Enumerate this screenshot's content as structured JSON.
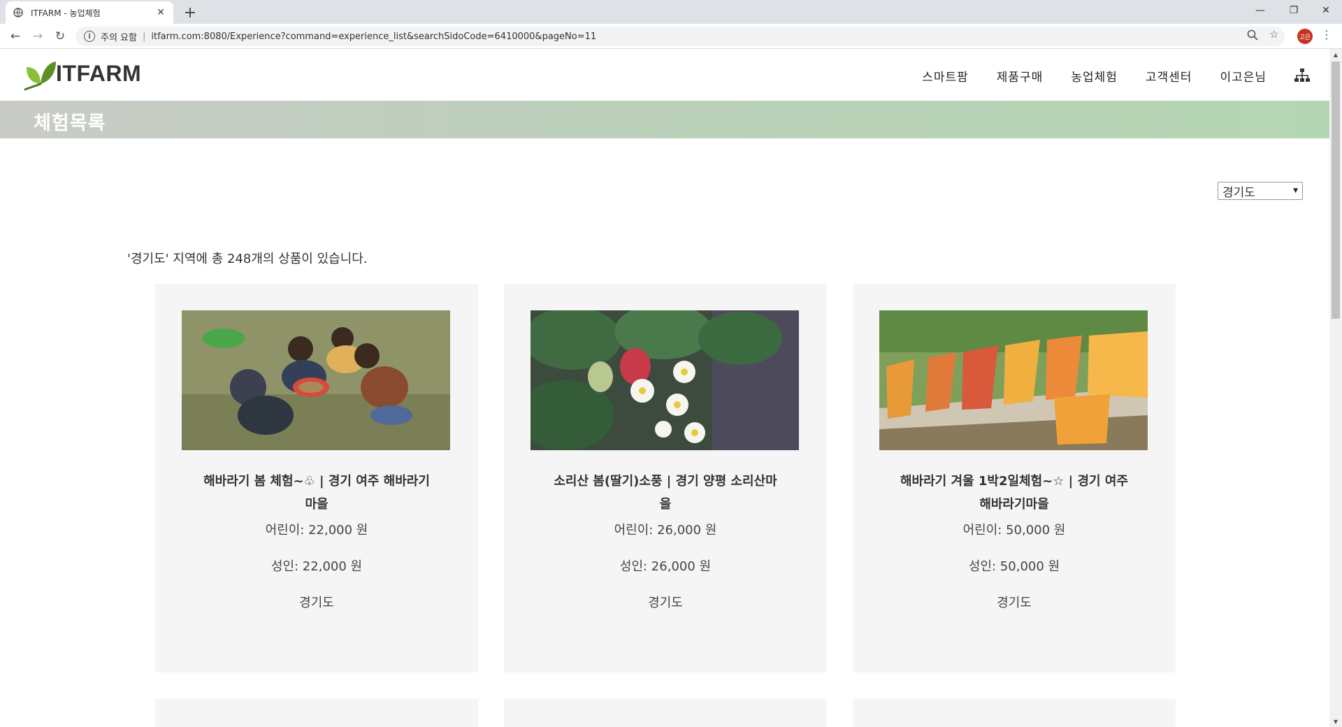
{
  "browser": {
    "tab_title": "ITFARM - 농업체험",
    "new_tab": "+",
    "security_label": "주의 요함",
    "url": "itfarm.com:8080/Experience?command=experience_list&searchSidoCode=6410000&pageNo=11",
    "profile_initials": "고은"
  },
  "site": {
    "logo_text": "ITFARM",
    "nav": [
      "스마트팜",
      "제품구매",
      "농업체험",
      "고객센터",
      "이고은님"
    ],
    "page_title": "체험목록"
  },
  "filter": {
    "region_selected": "경기도"
  },
  "summary_text": "'경기도' 지역에 총 248개의 상품이 있습니다.",
  "products": [
    {
      "name": "해바라기 봄 체험~♧ | 경기 여주 해바라기마을",
      "child_price": "어린이: 22,000 원",
      "adult_price": "성인: 22,000 원",
      "region": "경기도"
    },
    {
      "name": "소리산 봄(딸기)소풍 | 경기 양평 소리산마을",
      "child_price": "어린이: 26,000 원",
      "adult_price": "성인: 26,000 원",
      "region": "경기도"
    },
    {
      "name": "해바라기 겨울 1박2일체험~☆ | 경기 여주 해바라기마을",
      "child_price": "어린이: 50,000 원",
      "adult_price": "성인: 50,000 원",
      "region": "경기도"
    }
  ],
  "colors": {
    "banner_start": "#c9cbc7",
    "banner_end": "#b5d6b3",
    "card_bg": "#f5f5f5",
    "logo_leaf": "#6a9a2a"
  }
}
